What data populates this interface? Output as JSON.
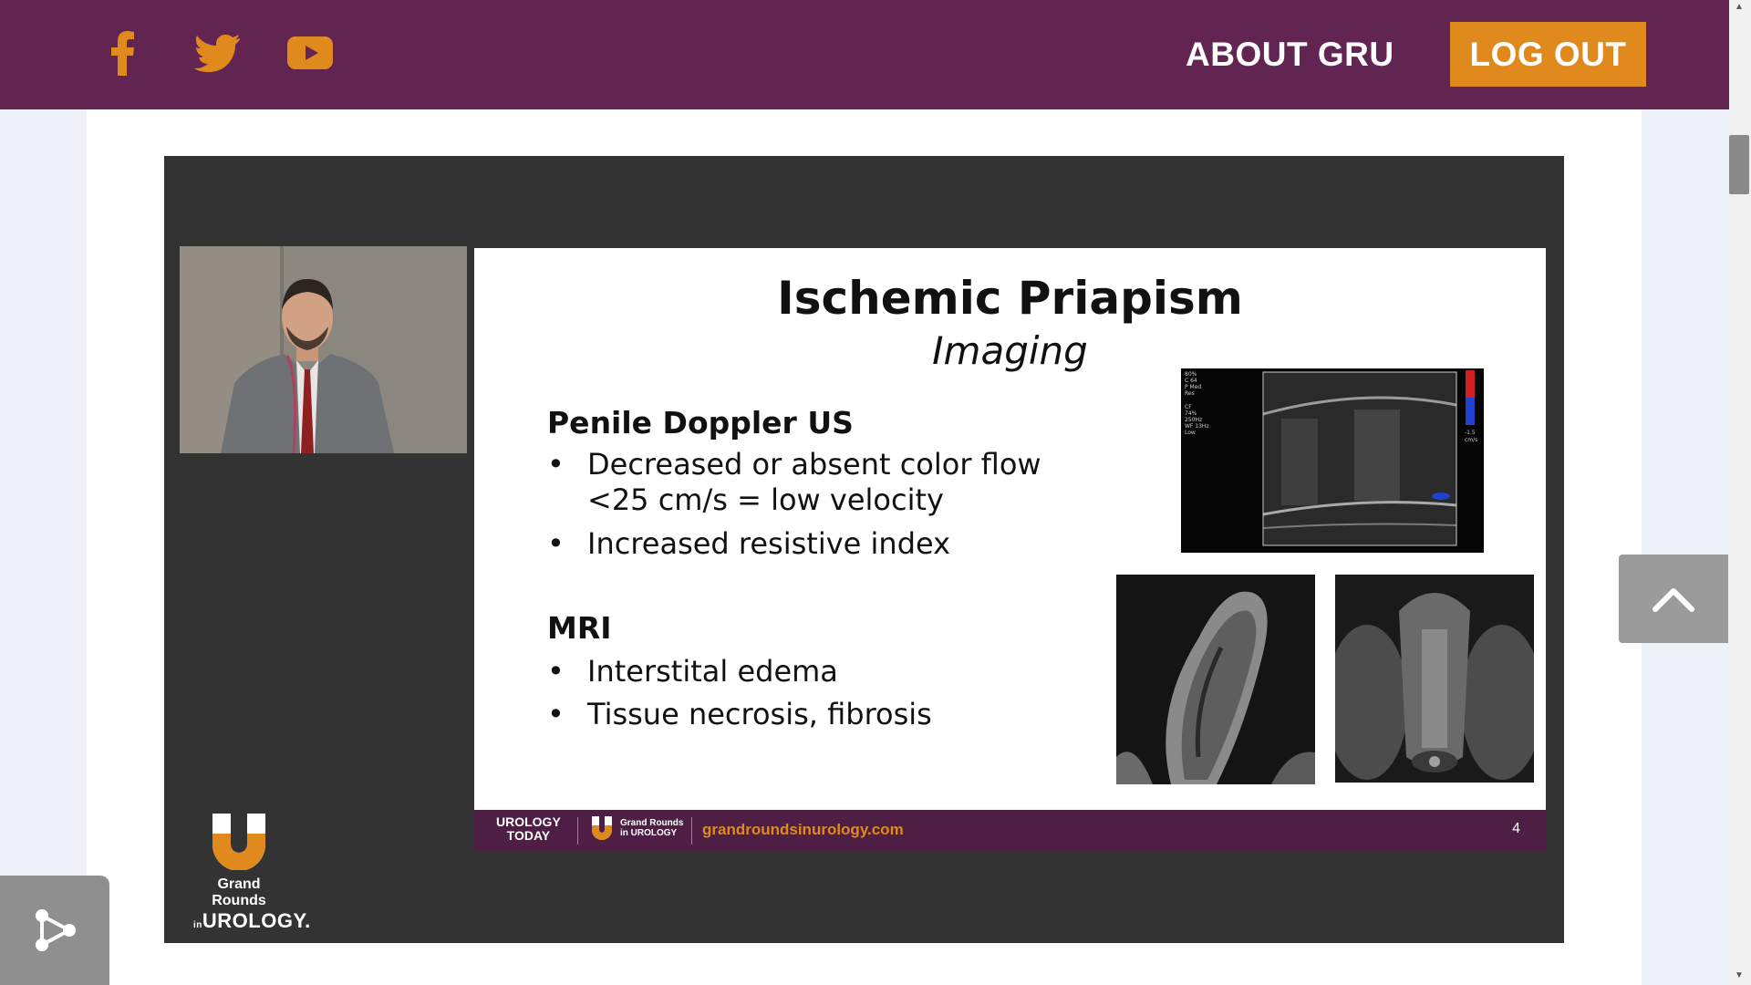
{
  "nav": {
    "social": [
      {
        "name": "facebook-icon"
      },
      {
        "name": "twitter-icon"
      },
      {
        "name": "youtube-icon"
      }
    ],
    "about_label": "ABOUT GRU",
    "logout_label": "LOG OUT",
    "colors": {
      "bar": "#622552",
      "accent": "#e08a1e"
    }
  },
  "slide": {
    "title": "Ischemic Priapism",
    "subtitle": "Imaging",
    "section1": {
      "heading": "Penile Doppler US",
      "bullets": [
        "Decreased or absent color flow\n<25 cm/s = low velocity",
        "Increased resistive index"
      ]
    },
    "section2": {
      "heading": "MRI",
      "bullets": [
        "Interstital edema",
        "Tissue necrosis, fibrosis"
      ]
    },
    "bullet_char": "•",
    "footer": {
      "brand1": "UROLOGY\nTODAY",
      "brand2": "Grand Rounds\nin UROLOGY",
      "url": "grandroundsinurology.com",
      "page": "4"
    }
  },
  "watermark": {
    "line1": "Grand Rounds",
    "line2_prefix": "in",
    "line2": "UROLOGY."
  },
  "controls": {
    "scroll_top_icon": "chevron-up-icon",
    "share_icon": "share-icon"
  }
}
